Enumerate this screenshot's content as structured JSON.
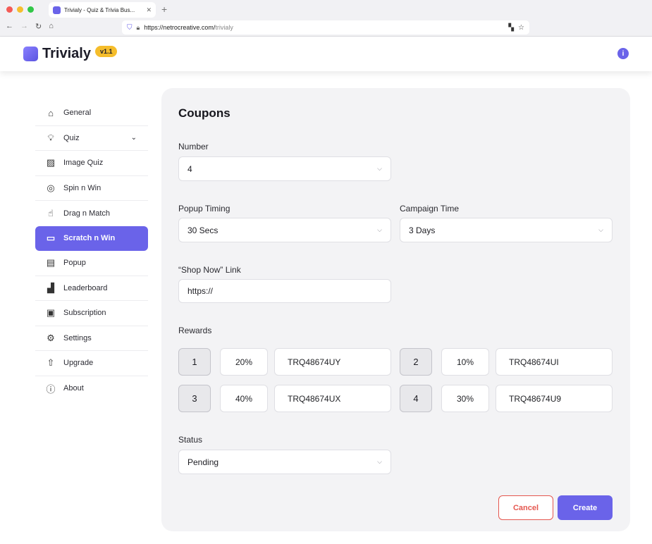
{
  "browser": {
    "tab_title": "Trivialy - Quiz & Trivia Bus...",
    "url_host": "https://netrocreative.com/",
    "url_path": "trivialy",
    "colors": {
      "close": "#f45b56",
      "minimize": "#f6be2e",
      "maximize": "#32c748"
    }
  },
  "app": {
    "name": "Trivialy",
    "version": "v1.1"
  },
  "sidebar": {
    "items": [
      {
        "label": "General",
        "icon": "home-icon"
      },
      {
        "label": "Quiz",
        "icon": "lightbulb-icon"
      },
      {
        "label": "Image Quiz",
        "icon": "image-icon"
      },
      {
        "label": "Spin n Win",
        "icon": "target-icon"
      },
      {
        "label": "Drag n Match",
        "icon": "drag-icon"
      },
      {
        "label": "Scratch n Win",
        "icon": "ticket-icon"
      },
      {
        "label": "Popup",
        "icon": "popup-icon"
      },
      {
        "label": "Leaderboard",
        "icon": "podium-icon"
      },
      {
        "label": "Subscription",
        "icon": "subscription-icon"
      },
      {
        "label": "Settings",
        "icon": "gear-icon"
      },
      {
        "label": "Upgrade",
        "icon": "upgrade-icon"
      },
      {
        "label": "About",
        "icon": "info-icon"
      }
    ]
  },
  "form": {
    "title": "Coupons",
    "number": {
      "label": "Number",
      "value": "4"
    },
    "popup_timing": {
      "label": "Popup Timing",
      "value": "30 Secs"
    },
    "campaign_time": {
      "label": "Campaign Time",
      "value": "3 Days"
    },
    "shop_link": {
      "label": "“Shop Now” Link",
      "value": "https://"
    },
    "rewards_label": "Rewards",
    "rewards": [
      {
        "num": "1",
        "pct": "20%",
        "code": "TRQ48674UY"
      },
      {
        "num": "2",
        "pct": "10%",
        "code": "TRQ48674UI"
      },
      {
        "num": "3",
        "pct": "40%",
        "code": "TRQ48674UX"
      },
      {
        "num": "4",
        "pct": "30%",
        "code": "TRQ48674U9"
      }
    ],
    "status": {
      "label": "Status",
      "value": "Pending"
    },
    "cancel_label": "Cancel",
    "create_label": "Create"
  },
  "accent_color": "#6a63e9"
}
